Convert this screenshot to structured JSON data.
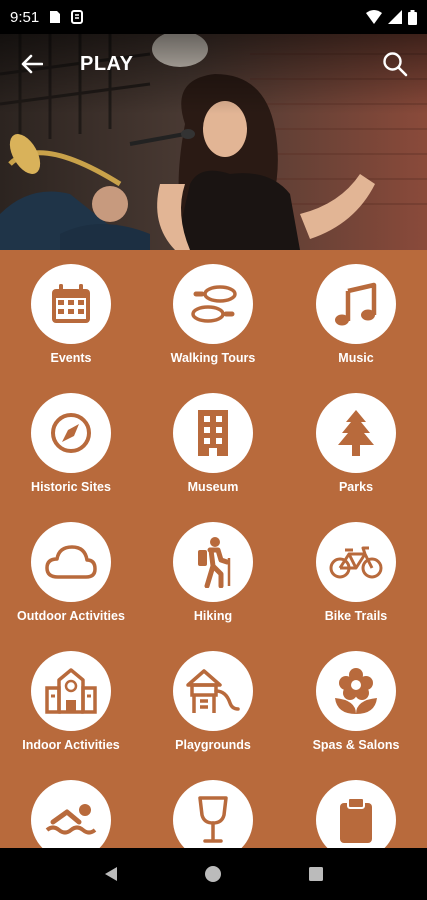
{
  "status_bar": {
    "time": "9:51"
  },
  "app_bar": {
    "title": "PLAY"
  },
  "colors": {
    "accent": "#b86a3c",
    "icon": "#b86a3c"
  },
  "categories": [
    {
      "label": "Events",
      "icon": "calendar-icon"
    },
    {
      "label": "Walking Tours",
      "icon": "footprints-icon"
    },
    {
      "label": "Music",
      "icon": "music-note-icon"
    },
    {
      "label": "Historic Sites",
      "icon": "compass-icon"
    },
    {
      "label": "Museum",
      "icon": "building-icon"
    },
    {
      "label": "Parks",
      "icon": "tree-icon"
    },
    {
      "label": "Outdoor Activities",
      "icon": "cloud-icon"
    },
    {
      "label": "Hiking",
      "icon": "hiker-icon"
    },
    {
      "label": "Bike Trails",
      "icon": "bicycle-icon"
    },
    {
      "label": "Indoor Activities",
      "icon": "school-building-icon"
    },
    {
      "label": "Playgrounds",
      "icon": "playground-icon"
    },
    {
      "label": "Spas & Salons",
      "icon": "flower-icon"
    },
    {
      "label": "",
      "icon": "swimmer-icon"
    },
    {
      "label": "",
      "icon": "wine-glass-icon"
    },
    {
      "label": "",
      "icon": "clipboard-icon"
    }
  ]
}
